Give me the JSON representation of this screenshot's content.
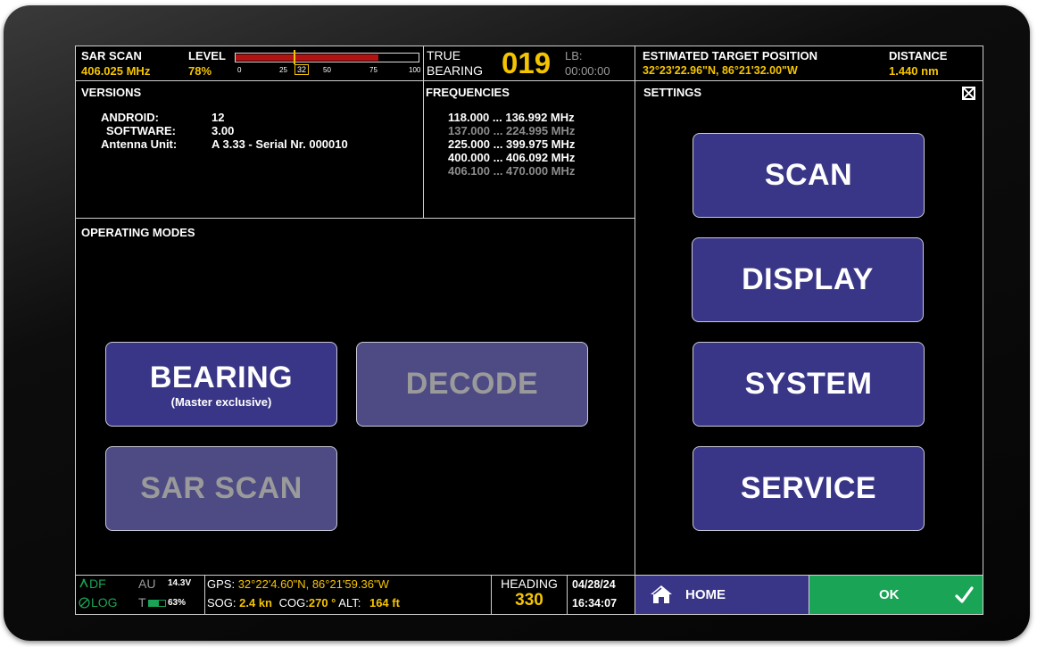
{
  "header": {
    "sar_scan_title": "SAR SCAN",
    "sar_scan_freq": "406.025 MHz",
    "level_label": "LEVEL",
    "level_percent": "78%",
    "level_value": 0.78,
    "level_ticks": [
      "0",
      "25",
      "32",
      "50",
      "75",
      "100"
    ],
    "level_marker": "32",
    "true_label": "TRUE",
    "bearing_label": "BEARING",
    "bearing_value": "019",
    "lb_label": "LB:",
    "lb_time": "00:00:00",
    "est_title": "ESTIMATED TARGET POSITION",
    "est_coords": "32°23'22.96\"N,  86°21'32.00\"W",
    "distance_label": "DISTANCE",
    "distance_value": "1.440 nm"
  },
  "versions": {
    "title": "VERSIONS",
    "android_label": "ANDROID:",
    "android_value": "12",
    "software_label": "SOFTWARE:",
    "software_value": "3.00",
    "antenna_label": "Antenna Unit:",
    "antenna_value": "A 3.33 - Serial Nr. 000010"
  },
  "frequencies": {
    "title": "FREQUENCIES",
    "items": [
      {
        "text": "118.000 ... 136.992 MHz",
        "active": true
      },
      {
        "text": "137.000 ... 224.995 MHz",
        "active": false
      },
      {
        "text": "225.000 ... 399.975 MHz",
        "active": true
      },
      {
        "text": "400.000 ... 406.092 MHz",
        "active": true
      },
      {
        "text": "406.100 ... 470.000 MHz",
        "active": false
      }
    ]
  },
  "modes": {
    "title": "OPERATING MODES",
    "bearing": "BEARING",
    "bearing_sub": "(Master exclusive)",
    "decode": "DECODE",
    "sar_scan": "SAR SCAN"
  },
  "settings": {
    "title": "SETTINGS",
    "scan": "SCAN",
    "display": "DISPLAY",
    "system": "SYSTEM",
    "service": "SERVICE"
  },
  "status": {
    "df": "DF",
    "log": "LOG",
    "au": "AU",
    "voltage": "14.3V",
    "t": "T",
    "battery": "63%",
    "gps_label": "GPS:",
    "gps_value": "32°22'4.60\"N,  86°21'59.36\"W",
    "sog_label": "SOG:",
    "sog_value": "2.4 kn",
    "cog_label": "COG:",
    "cog_value": "270 °",
    "alt_label": "ALT:",
    "alt_value": "164 ft",
    "heading_label": "HEADING",
    "heading_value": "330",
    "date": "04/28/24",
    "time": "16:34:07",
    "home": "HOME",
    "ok": "OK"
  },
  "colors": {
    "button": "#3a3687",
    "accent_yellow": "#f5c400",
    "ok_green": "#1aa456",
    "level_red": "#b31212"
  }
}
